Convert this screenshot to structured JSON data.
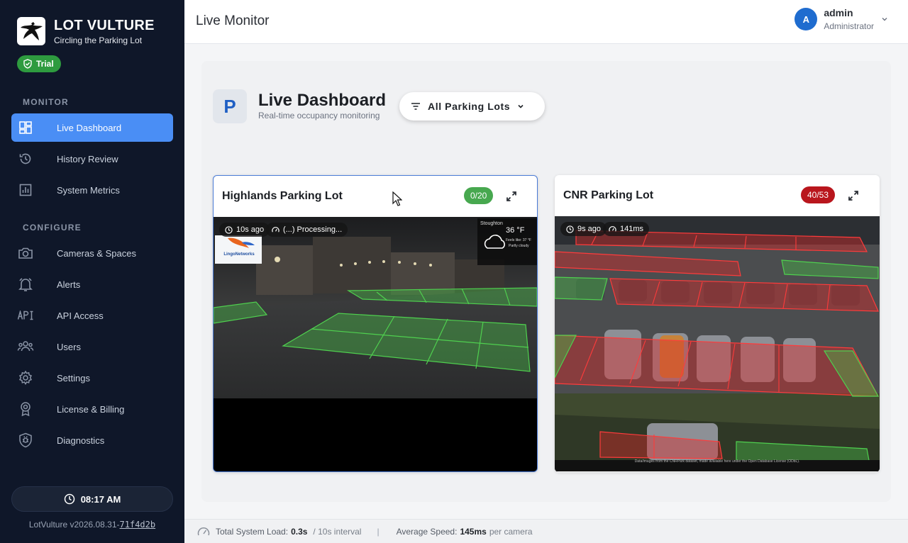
{
  "brand": {
    "name": "LOT VULTURE",
    "tagline": "Circling the Parking Lot",
    "badge": "Trial"
  },
  "sidebar": {
    "sections": [
      {
        "label": "MONITOR",
        "items": [
          {
            "label": "Live Dashboard",
            "icon": "dashboard-icon",
            "active": true
          },
          {
            "label": "History Review",
            "icon": "history-icon"
          },
          {
            "label": "System Metrics",
            "icon": "bar-chart-icon"
          }
        ]
      },
      {
        "label": "CONFIGURE",
        "items": [
          {
            "label": "Cameras & Spaces",
            "icon": "camera-icon"
          },
          {
            "label": "Alerts",
            "icon": "bell-icon"
          },
          {
            "label": "API Access",
            "icon": "api-icon"
          },
          {
            "label": "Users",
            "icon": "users-icon"
          },
          {
            "label": "Settings",
            "icon": "gear-icon"
          },
          {
            "label": "License & Billing",
            "icon": "license-icon"
          },
          {
            "label": "Diagnostics",
            "icon": "shield-bug-icon"
          }
        ]
      }
    ],
    "clock": "08:17 AM",
    "version_prefix": "LotVulture v2026.08.31-",
    "version_hash": "71f4d2b"
  },
  "header": {
    "title": "Live Monitor",
    "user": {
      "initial": "A",
      "name": "admin",
      "role": "Administrator"
    }
  },
  "dashboard": {
    "title": "Live Dashboard",
    "subtitle": "Real-time occupancy monitoring",
    "filter_label": "All Parking Lots",
    "cards": [
      {
        "title": "Highlands Parking Lot",
        "occupancy": "0/20",
        "status_color": "#47a84f",
        "age": "10s ago",
        "speed": "(...) Processing...",
        "selected": true,
        "overlay": {
          "location": "Stoughton",
          "temp": "36 °F",
          "feels_like": "Feels like: 37 °F",
          "condition": "Partly cloudy",
          "logo": "LingoNetworks"
        }
      },
      {
        "title": "CNR Parking Lot",
        "occupancy": "40/53",
        "status_color": "#b9161d",
        "age": "9s ago",
        "speed": "141ms",
        "selected": false,
        "footer_note": "Data/images from the CNRPark dataset, made available here under the Open Database License (ODbL)."
      }
    ]
  },
  "statusbar": {
    "load_label": "Total System Load:",
    "load_value": "0.3s",
    "interval": "/ 10s interval",
    "speed_label": "Average Speed:",
    "speed_value": "145ms",
    "speed_unit": "per camera"
  }
}
